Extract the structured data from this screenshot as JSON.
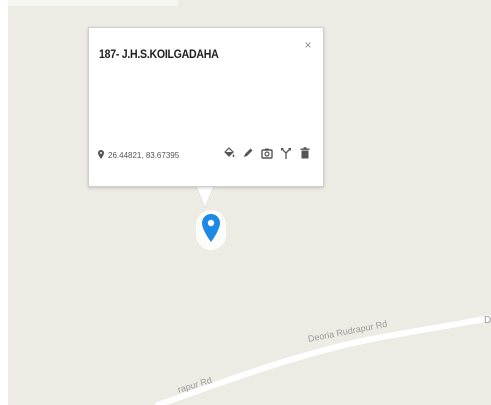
{
  "infowindow": {
    "title": "187- J.H.S.KOILGADAHA",
    "close_glyph": "×",
    "coordinates": "26.44821, 83.67395",
    "actions": [
      "paint-bucket-icon",
      "pencil-icon",
      "camera-icon",
      "directions-icon",
      "trash-icon"
    ]
  },
  "map": {
    "road_labels": [
      "Deoria Rudrapur Rd",
      "rapur Rd",
      "D"
    ],
    "colors": {
      "background": "#ecebe4",
      "road": "#ffffff",
      "marker": "#1e88e5"
    }
  }
}
